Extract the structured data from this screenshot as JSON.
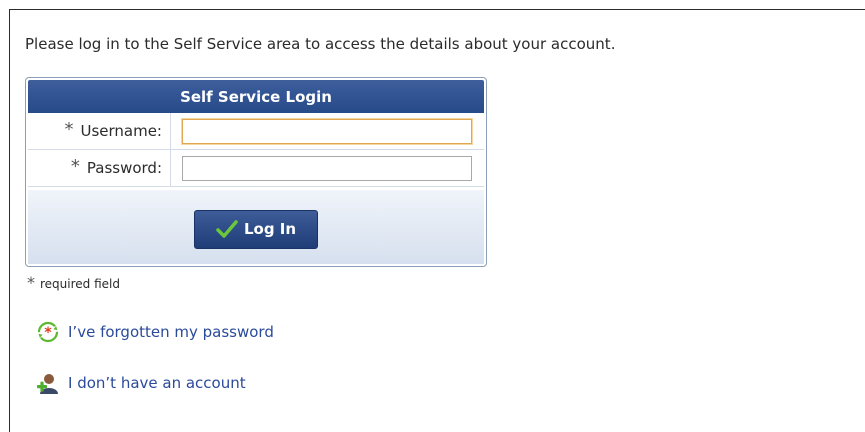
{
  "intro_text": "Please log in to the Self Service area to access the details about your account.",
  "login": {
    "title": "Self Service Login",
    "required_marker": "*",
    "username_label": "Username:",
    "username_value": "",
    "password_label": "Password:",
    "password_value": "",
    "submit_label": "Log In"
  },
  "required_note": "required field",
  "links": {
    "forgot_password": "I’ve forgotten my password",
    "no_account": "I don’t have an account"
  },
  "icons": {
    "submit": "checkmark-icon",
    "forgot_password": "password-reset-icon",
    "no_account": "add-user-icon"
  },
  "colors": {
    "header_blue": "#2f4f8f",
    "link_blue": "#2b4a9a",
    "focus_orange": "#e0a850",
    "check_green": "#5cb82f"
  }
}
